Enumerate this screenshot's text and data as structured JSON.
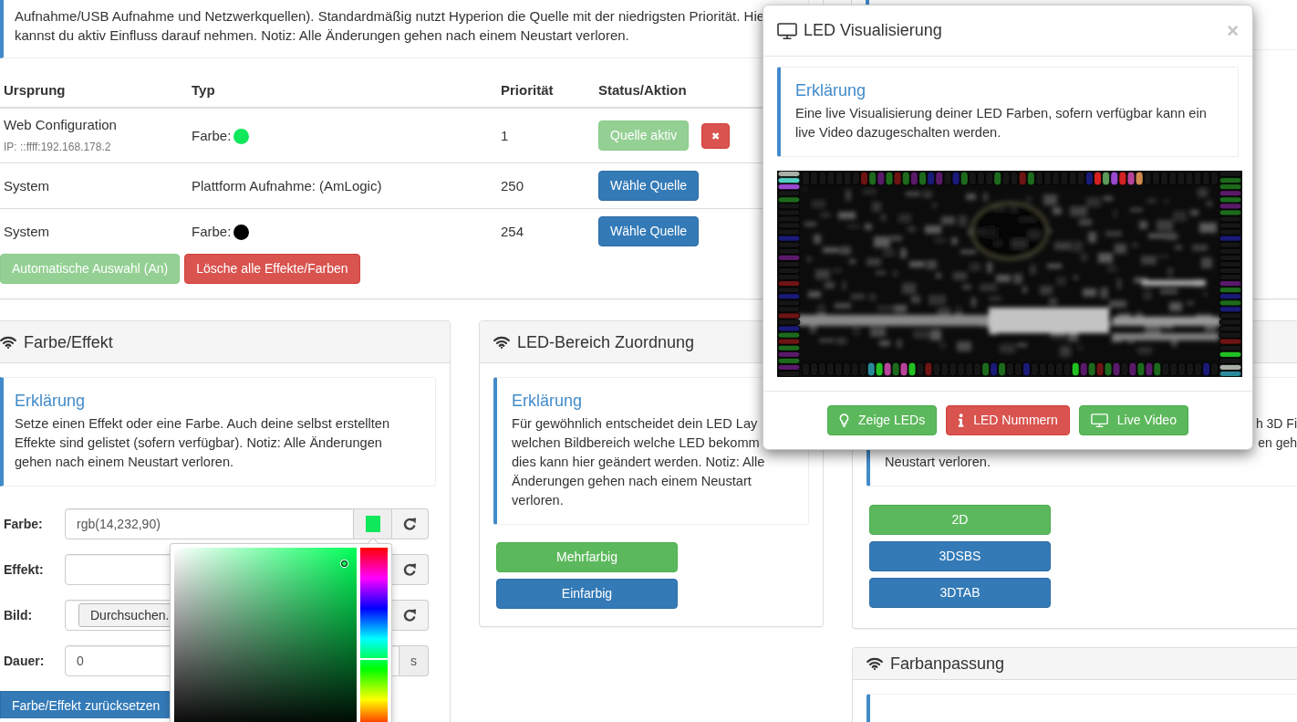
{
  "sources_panel": {
    "callout": {
      "text": "Aufnahme/USB Aufnahme und Netzwerkquellen). Standardmäßig nutzt Hyperion die Quelle mit der niedrigsten Priorität. Hie kannst du aktiv Einfluss darauf nehmen. Notiz: Alle Änderungen gehen nach einem Neustart verloren."
    },
    "table": {
      "columns": [
        "Ursprung",
        "Typ",
        "Priorität",
        "Status/Aktion"
      ],
      "rows": [
        {
          "origin": "Web Configuration",
          "origin_detail": "IP: ::ffff:192.168.178.2",
          "type": "Farbe:",
          "color": "#0ee85a",
          "priority": "1",
          "selected": true,
          "action": "Quelle aktiv",
          "remove": "✖"
        },
        {
          "origin": "System",
          "type": "Plattform Aufnahme: (AmLogic)",
          "priority": "250",
          "selected": false,
          "action": "Wähle Quelle"
        },
        {
          "origin": "System",
          "type": "Farbe:",
          "color": "#000000",
          "priority": "254",
          "selected": false,
          "action": "Wähle Quelle"
        }
      ]
    },
    "buttons": [
      {
        "label": "Automatische Auswahl (An)",
        "kind": "success",
        "disabled": true
      },
      {
        "label": "Lösche alle Effekte/Farben",
        "kind": "danger",
        "disabled": false
      }
    ]
  },
  "effect_panel": {
    "title": "Farbe/Effekt",
    "callout": {
      "title": "Erklärung",
      "text": "Setze einen Effekt oder eine Farbe. Auch deine selbst erstellten Effekte sind gelistet (sofern verfügbar). Notiz: Alle Änderungen gehen nach einem Neustart verloren."
    },
    "fields": [
      {
        "kind": "color",
        "label": "Farbe:",
        "value": "rgb(14,232,90)",
        "color": "#0ee85a",
        "picker_open": true
      },
      {
        "kind": "select",
        "label": "Effekt:"
      },
      {
        "kind": "file",
        "label": "Bild:",
        "button": "Durchsuchen."
      },
      {
        "kind": "number",
        "label": "Dauer:",
        "value": "0",
        "unit": "s"
      }
    ],
    "reset_button": "Farbe/Effekt zurücksetzen"
  },
  "mapping_panel": {
    "title": "LED-Bereich Zuordnung",
    "callout": {
      "title": "Erklärung",
      "text": "Für gewöhnlich entscheidet dein LED Lay welchen Bildbereich welche LED bekomm dies kann hier geändert werden. Notiz: Alle Änderungen gehen nach einem Neustart verloren."
    },
    "buttons": [
      {
        "label": "Mehrfarbig",
        "selected": true
      },
      {
        "label": "Einfarbig",
        "selected": false
      }
    ]
  },
  "mode_panel": {
    "callout": {
      "fragments": [
        "h 3D Fi",
        "en geh",
        "Neustart verloren."
      ]
    },
    "buttons": [
      {
        "label": "2D",
        "selected": true
      },
      {
        "label": "3DSBS",
        "selected": false
      },
      {
        "label": "3DTAB",
        "selected": false
      }
    ]
  },
  "adjustment_panel": {
    "title": "Farbanpassung"
  },
  "modal": {
    "title": "LED Visualisierung",
    "close": "×",
    "callout": {
      "title": "Erklärung",
      "text": "Eine live Visualisierung deiner LED Farben, sofern verfügbar kann ein live Video dazugeschalten werden."
    },
    "buttons": [
      {
        "label": "Zeige LEDs",
        "kind": "leds",
        "on": true
      },
      {
        "label": "LED Nummern",
        "kind": "numbers",
        "on": false
      },
      {
        "label": "Live Video",
        "kind": "video",
        "on": true
      }
    ]
  }
}
